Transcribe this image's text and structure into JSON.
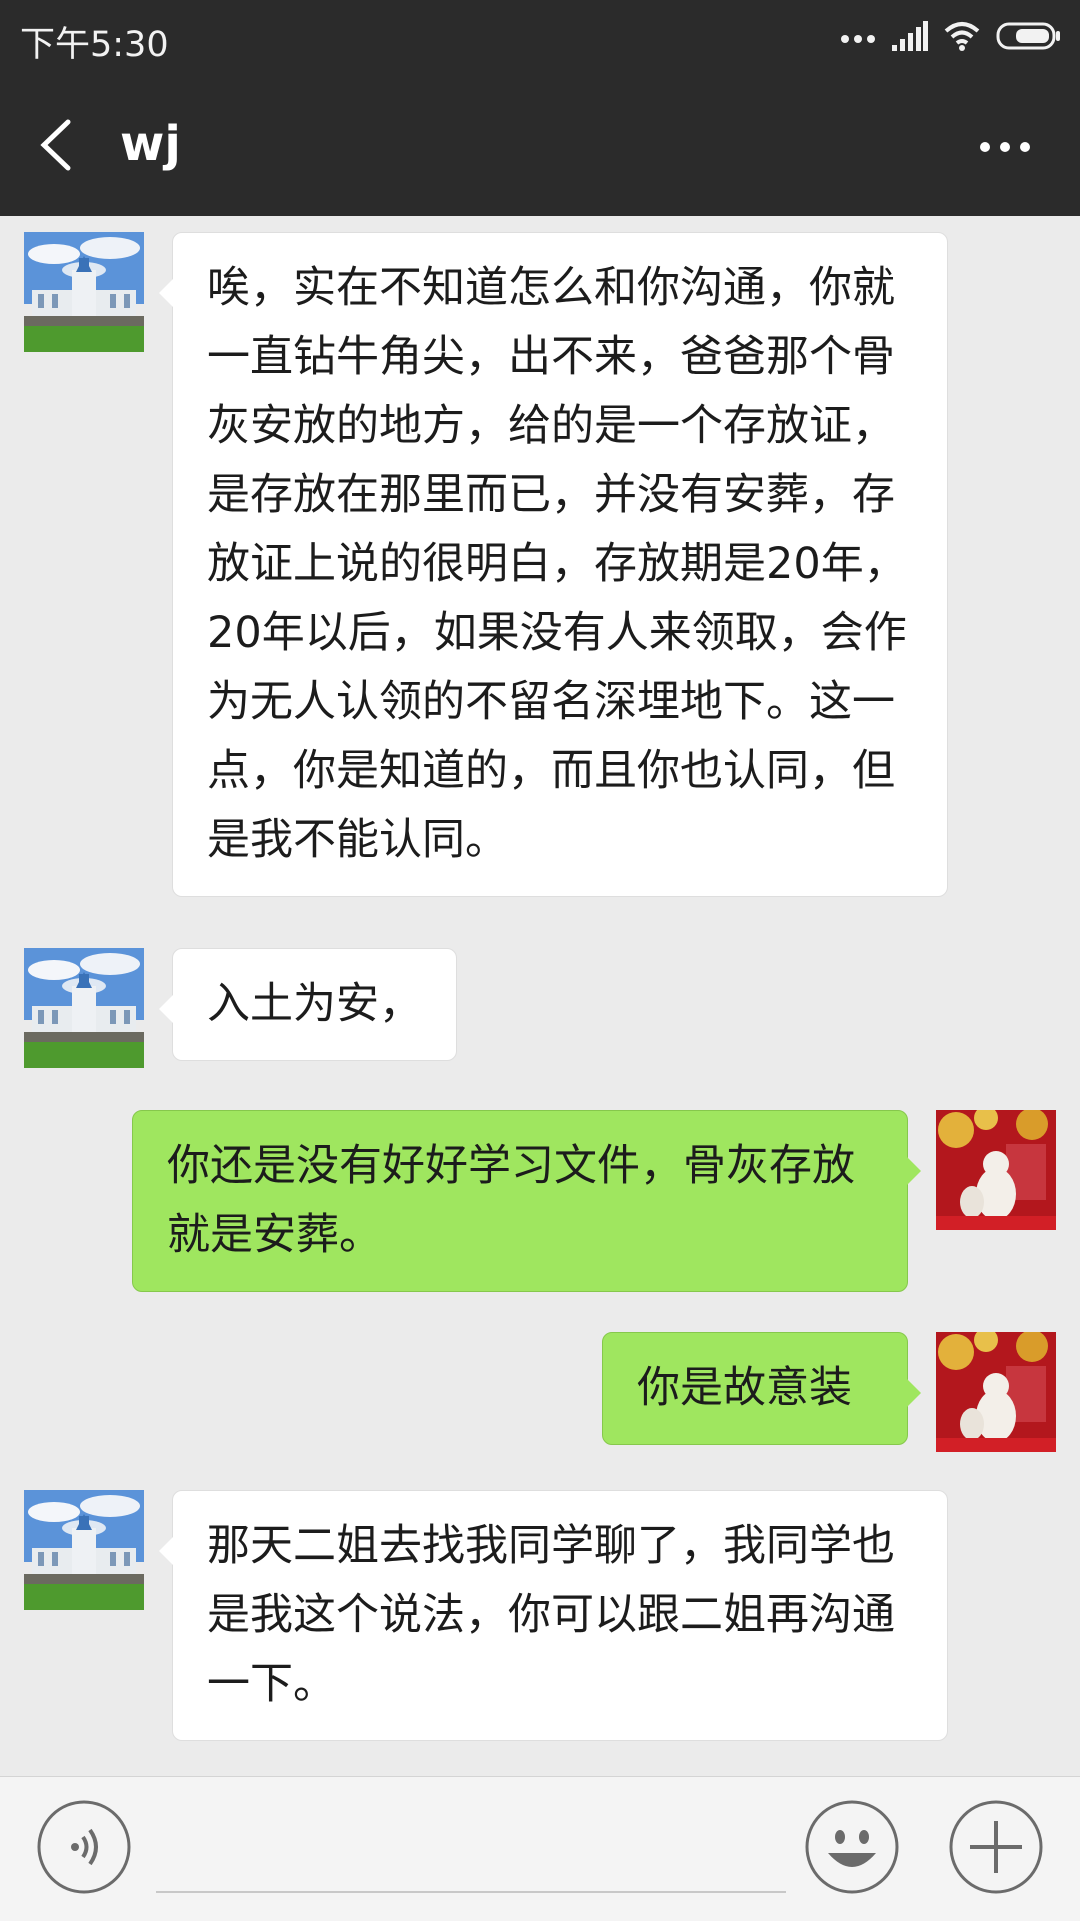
{
  "status_bar": {
    "time": "下午5:30"
  },
  "header": {
    "title": "wj",
    "back_icon": "chevron-left-icon",
    "more_icon": "more-horizontal-icon"
  },
  "messages": [
    {
      "direction": "incoming",
      "text": "唉，实在不知道怎么和你沟通，你就一直钻牛角尖，出不来，爸爸那个骨灰安放的地方，给的是一个存放证，是存放在那里而已，并没有安葬，存放证上说的很明白，存放期是20年，20年以后，如果没有人来领取，会作为无人认领的不留名深埋地下。这一点，你是知道的，而且你也认同，但是我不能认同。"
    },
    {
      "direction": "incoming",
      "text": "入土为安，"
    },
    {
      "direction": "outgoing",
      "text": "你还是没有好好学习文件，骨灰存放就是安葬。"
    },
    {
      "direction": "outgoing",
      "text": "你是故意装"
    },
    {
      "direction": "incoming",
      "text": "那天二姐去找我同学聊了，我同学也是我这个说法，你可以跟二姐再沟通一下。"
    }
  ],
  "input_bar": {
    "voice_icon": "voice-icon",
    "emoji_icon": "emoji-icon",
    "plus_icon": "plus-icon",
    "input_value": ""
  },
  "colors": {
    "header_bg": "#2b2b2b",
    "chat_bg": "#ebebeb",
    "incoming_bubble": "#ffffff",
    "outgoing_bubble": "#9fe65f"
  }
}
